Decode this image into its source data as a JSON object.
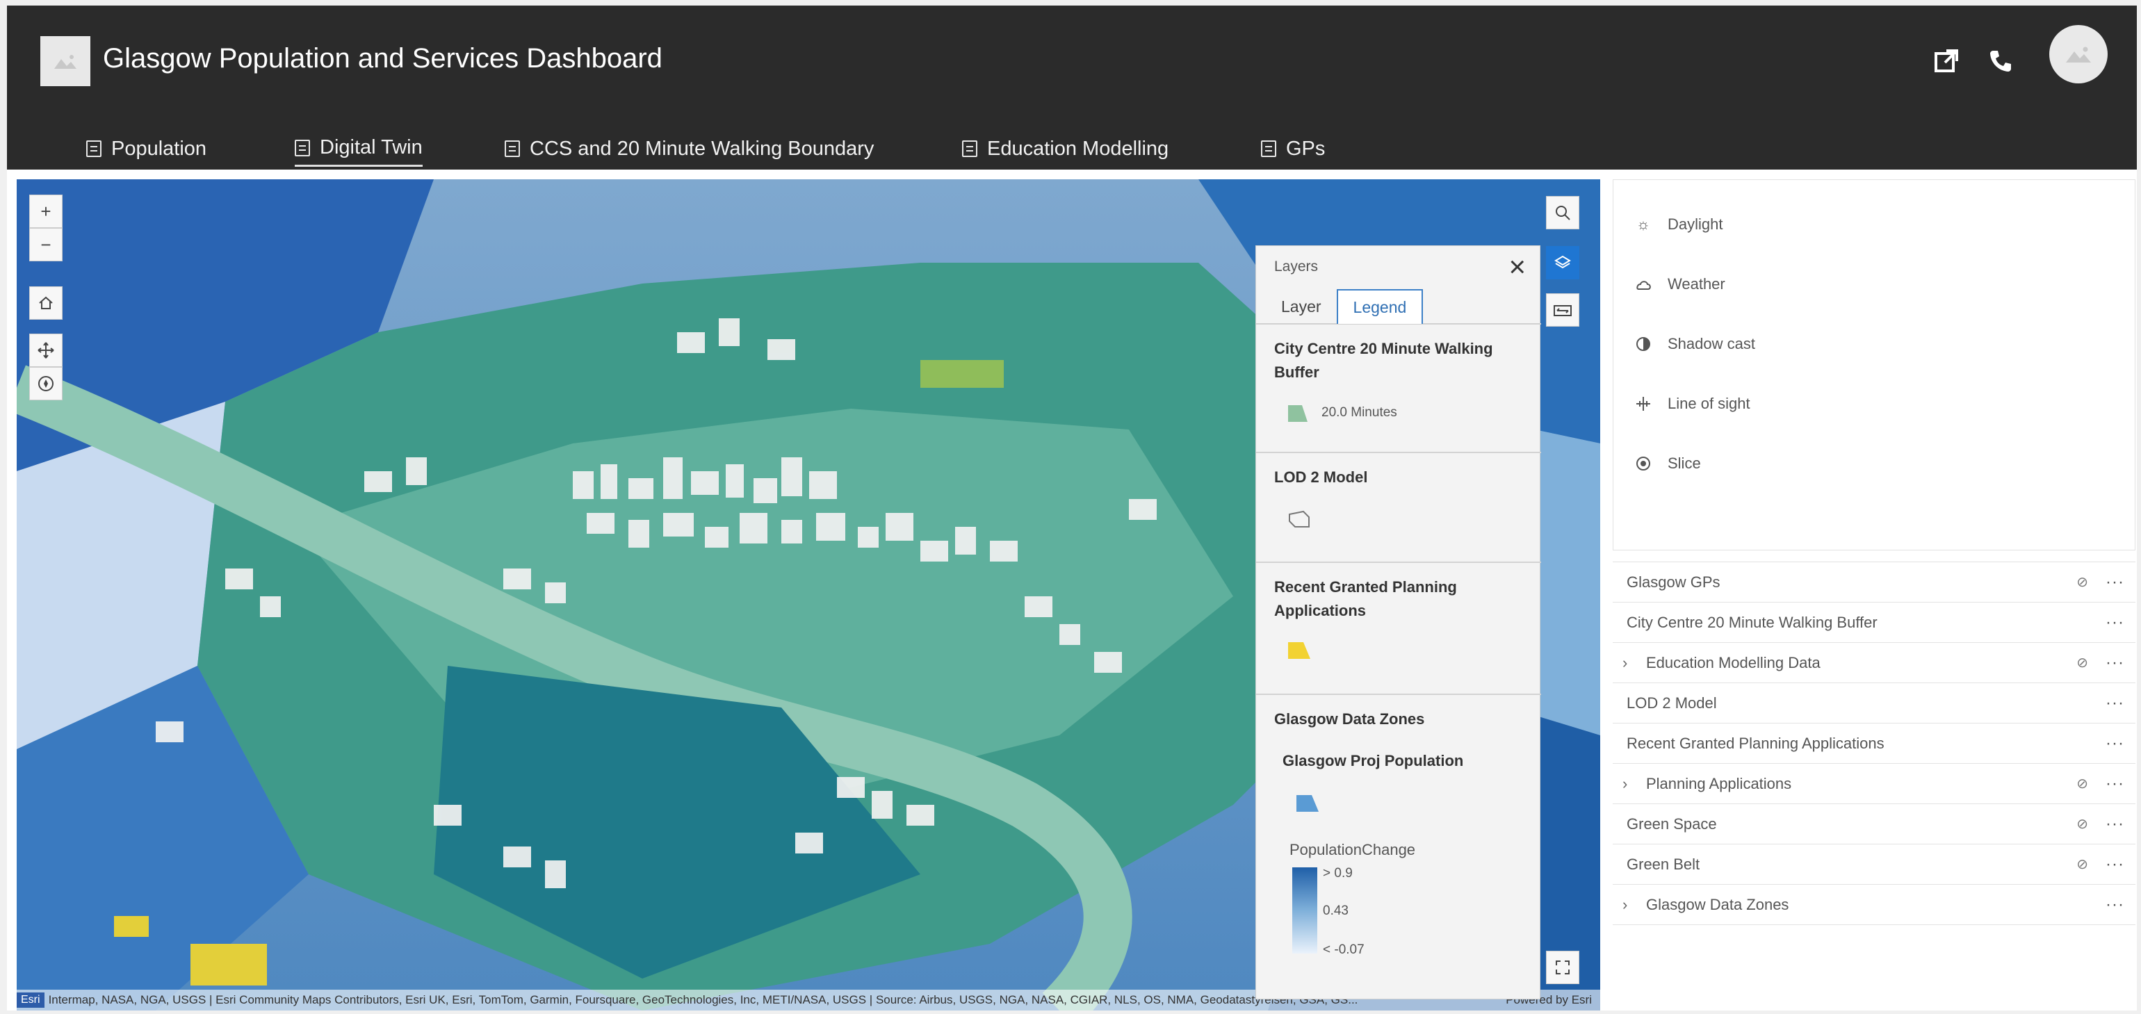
{
  "header": {
    "title": "Glasgow Population and Services Dashboard",
    "tabs": [
      {
        "label": "Population"
      },
      {
        "label": "Digital Twin"
      },
      {
        "label": "CCS and 20 Minute Walking Boundary"
      },
      {
        "label": "Education Modelling"
      },
      {
        "label": "GPs"
      }
    ],
    "active_tab": "Digital Twin"
  },
  "map": {
    "controls": [
      "zoom-in",
      "zoom-out",
      "home",
      "pan",
      "compass"
    ],
    "right_controls": [
      "search",
      "layers",
      "swipe",
      "fullscreen"
    ],
    "attribution": "Intermap, NASA, NGA, USGS | Esri Community Maps Contributors, Esri UK, Esri, TomTom, Garmin, Foursquare, GeoTechnologies, Inc, METI/NASA, USGS | Source: Airbus, USGS, NGA, NASA, CGIAR, NLS, OS, NMA, Geodatastyrelsen, GSA, GS...",
    "esri_badge": "Esri",
    "powered_by": "Powered by Esri"
  },
  "layers_panel": {
    "title": "Layers",
    "tabs": [
      "Layer",
      "Legend"
    ],
    "active_tab": "Legend",
    "sections": [
      {
        "heading": "City Centre 20 Minute Walking Buffer",
        "item": "20.0 Minutes"
      },
      {
        "heading": "LOD 2 Model"
      },
      {
        "heading": "Recent Granted Planning Applications"
      },
      {
        "heading": "Glasgow Data Zones",
        "subheading": "Glasgow Proj Population",
        "field": "PopulationChange",
        "ramp": [
          "> 0.9",
          "0.43",
          "< -0.07"
        ]
      }
    ],
    "colors": {
      "walk": "#8fc29f",
      "planning": "#f2d232",
      "proj": "#5a9bd4",
      "ramp_top": "#1f5fa8",
      "ramp_bottom": "#eaf2fb"
    }
  },
  "tools": [
    {
      "label": "Daylight",
      "icon": "sun-icon"
    },
    {
      "label": "Weather",
      "icon": "cloud-icon"
    },
    {
      "label": "Shadow cast",
      "icon": "shadow-icon"
    },
    {
      "label": "Line of sight",
      "icon": "line-of-sight-icon"
    },
    {
      "label": "Slice",
      "icon": "slice-icon"
    }
  ],
  "layer_list": [
    {
      "name": "Glasgow GPs",
      "hidden": true,
      "expandable": false
    },
    {
      "name": "City Centre 20 Minute Walking Buffer",
      "hidden": false,
      "expandable": false
    },
    {
      "name": "Education Modelling Data",
      "hidden": true,
      "expandable": true
    },
    {
      "name": "LOD 2 Model",
      "hidden": false,
      "expandable": false
    },
    {
      "name": "Recent Granted Planning Applications",
      "hidden": false,
      "expandable": false
    },
    {
      "name": "Planning Applications",
      "hidden": true,
      "expandable": true
    },
    {
      "name": "Green Space",
      "hidden": true,
      "expandable": false
    },
    {
      "name": "Green Belt",
      "hidden": true,
      "expandable": false
    },
    {
      "name": "Glasgow Data Zones",
      "hidden": false,
      "expandable": true
    }
  ]
}
